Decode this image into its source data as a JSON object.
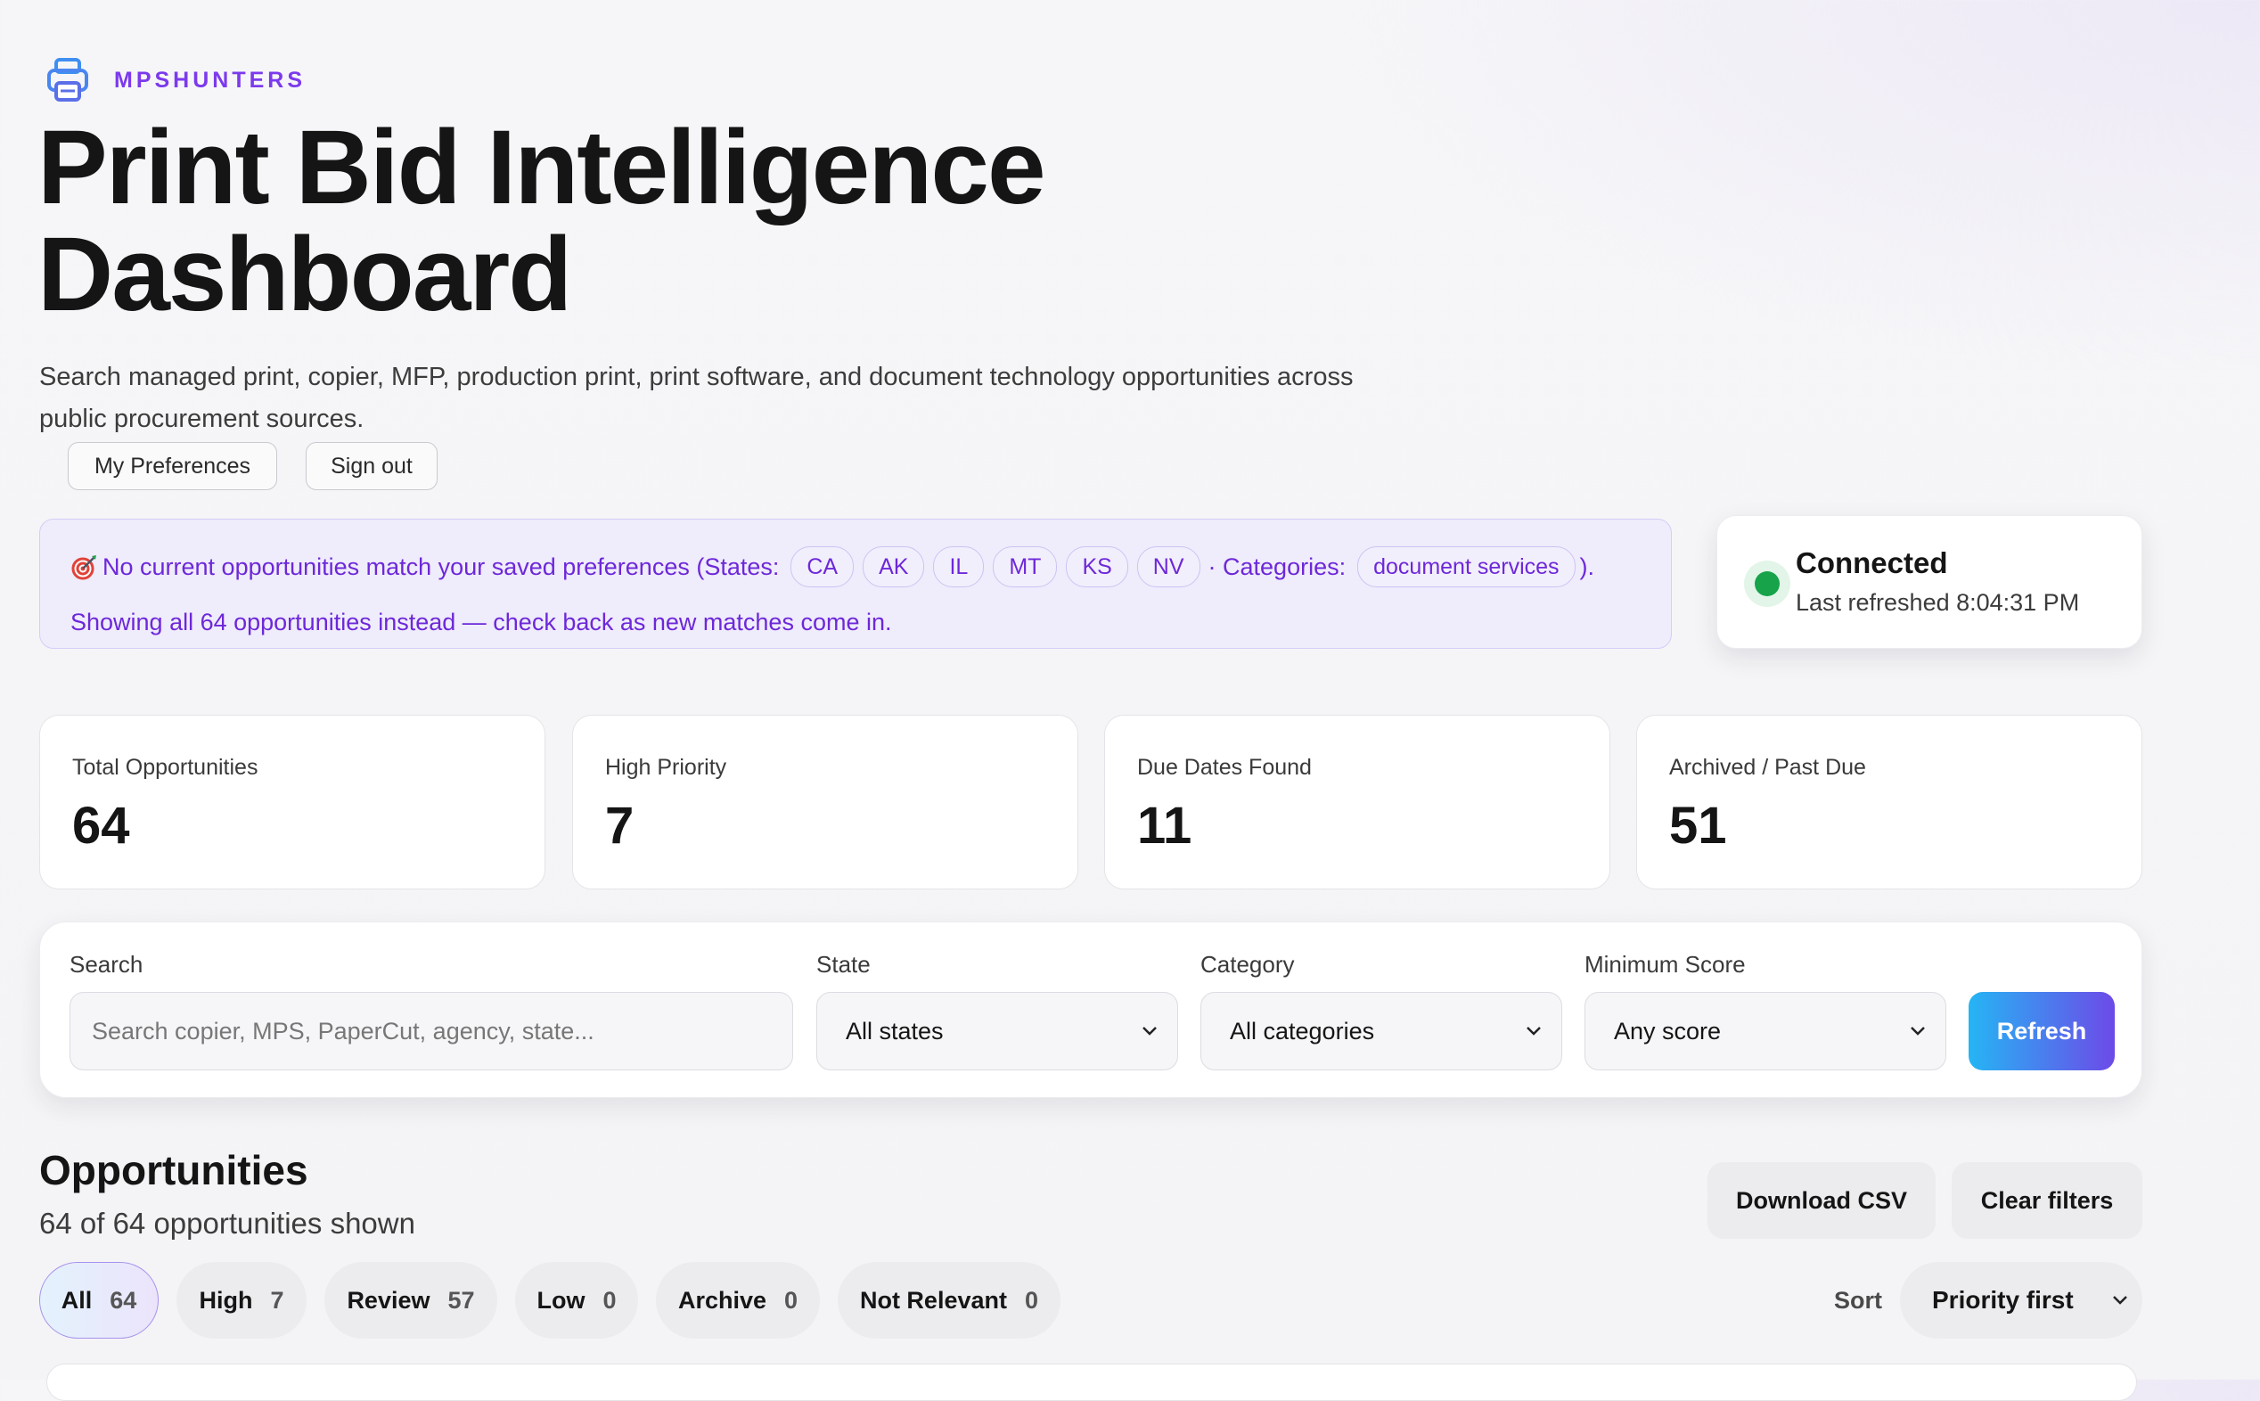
{
  "brand": {
    "name": "MPSHUNTERS",
    "icon": "printer-icon",
    "color": "#7c3aed"
  },
  "title": {
    "line1": "Print Bid Intelligence",
    "line2": "Dashboard"
  },
  "subtitle": "Search managed print, copier, MFP, production print, print software, and document technology opportunities across public procurement sources.",
  "top_actions": {
    "preferences": "My Preferences",
    "sign_out": "Sign out"
  },
  "notice": {
    "icon": "target-icon",
    "lead": "No current opportunities match your saved preferences (States:",
    "states": [
      "CA",
      "AK",
      "IL",
      "MT",
      "KS",
      "NV"
    ],
    "categories_label": "· Categories:",
    "categories": [
      "document services"
    ],
    "close": ").",
    "line2": "Showing all 64 opportunities instead — check back as new matches come in."
  },
  "connection": {
    "status": "Connected",
    "last_refreshed": "Last refreshed 8:04:31 PM",
    "color": "#16a34a"
  },
  "stats": [
    {
      "label": "Total Opportunities",
      "value": "64"
    },
    {
      "label": "High Priority",
      "value": "7"
    },
    {
      "label": "Due Dates Found",
      "value": "11"
    },
    {
      "label": "Archived / Past Due",
      "value": "51"
    }
  ],
  "filters": {
    "search": {
      "label": "Search",
      "placeholder": "Search copier, MPS, PaperCut, agency, state..."
    },
    "state": {
      "label": "State",
      "value": "All states"
    },
    "category": {
      "label": "Category",
      "value": "All categories"
    },
    "min_score": {
      "label": "Minimum Score",
      "value": "Any score"
    },
    "refresh": "Refresh"
  },
  "opportunities": {
    "title": "Opportunities",
    "count_text": "64 of 64 opportunities shown",
    "download_csv": "Download CSV",
    "clear_filters": "Clear filters",
    "tabs": [
      {
        "label": "All",
        "count": "64",
        "active": true
      },
      {
        "label": "High",
        "count": "7"
      },
      {
        "label": "Review",
        "count": "57"
      },
      {
        "label": "Low",
        "count": "0"
      },
      {
        "label": "Archive",
        "count": "0"
      },
      {
        "label": "Not Relevant",
        "count": "0"
      }
    ],
    "sort_label": "Sort",
    "sort_value": "Priority first"
  }
}
